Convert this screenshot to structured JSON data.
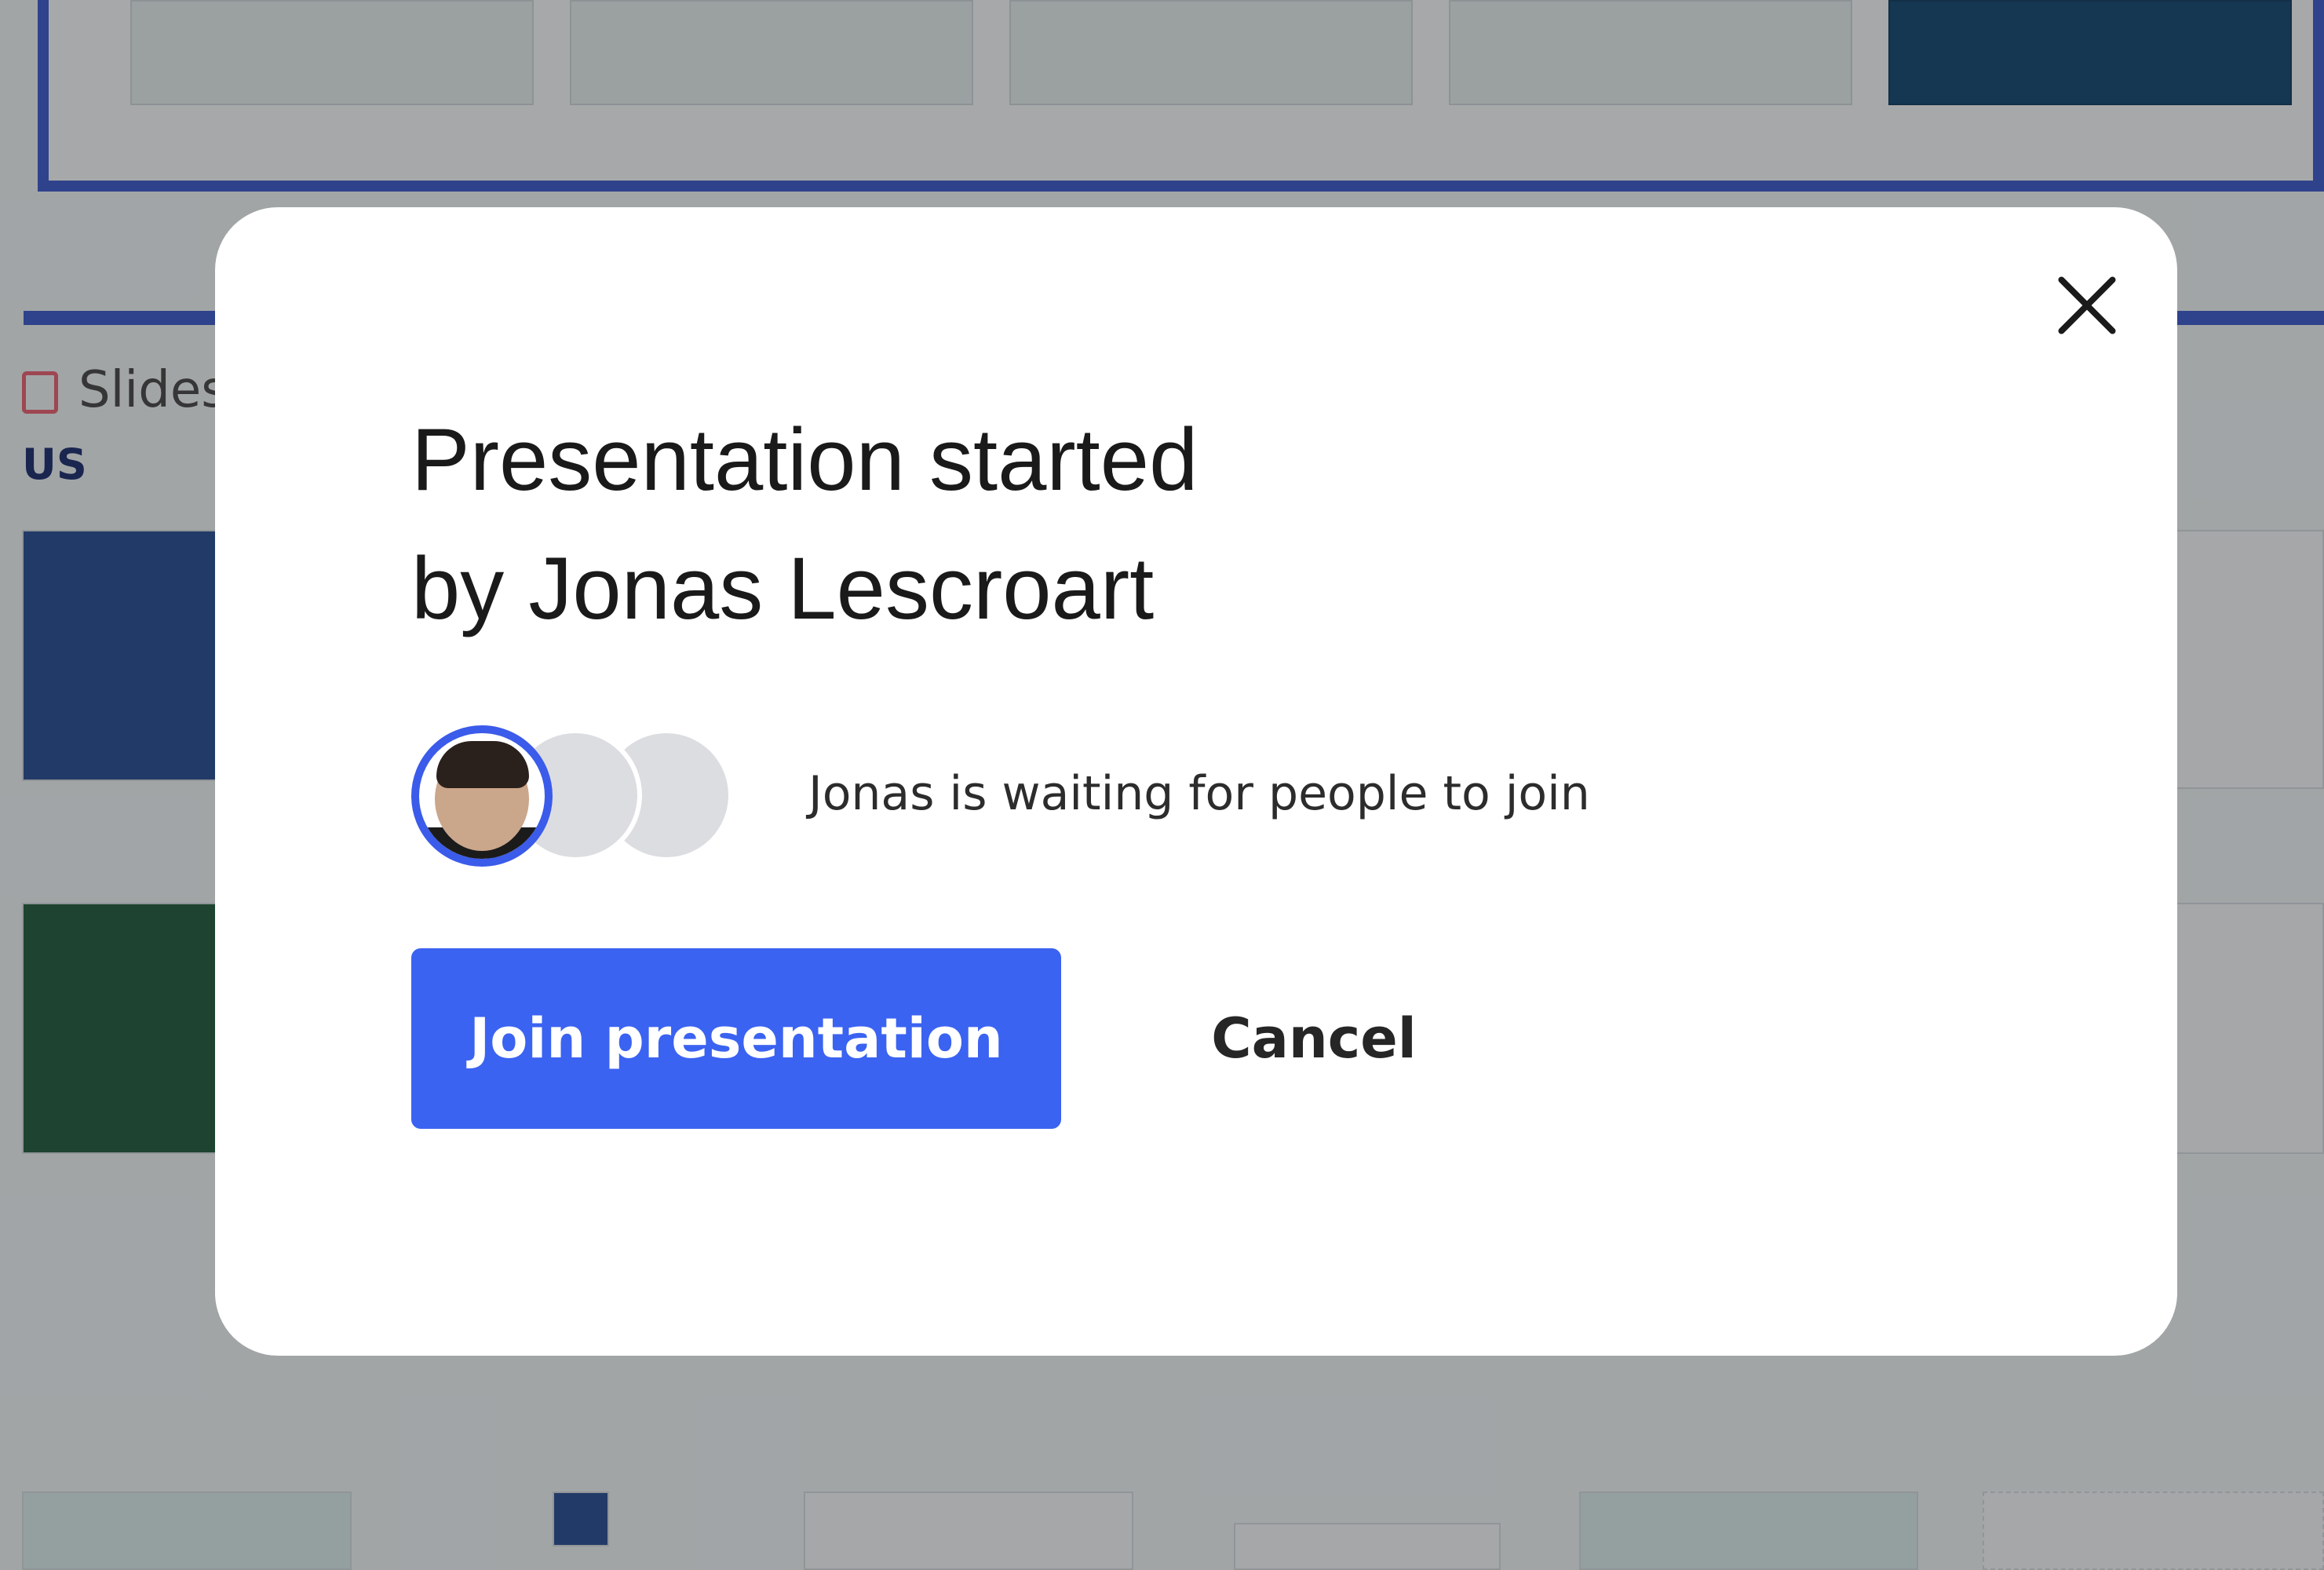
{
  "background": {
    "side_label": "Slides",
    "side_tag": "US"
  },
  "modal": {
    "title_line1": "Presentation started",
    "title_line2": "by Jonas Lescroart",
    "waiting_text": "Jonas is waiting for people to join",
    "join_label": "Join presentation",
    "cancel_label": "Cancel"
  },
  "colors": {
    "primary": "#3b63f1",
    "avatar_ring": "#3b5bea",
    "frame": "#3a56c8"
  },
  "icons": {
    "close": "close-icon"
  }
}
